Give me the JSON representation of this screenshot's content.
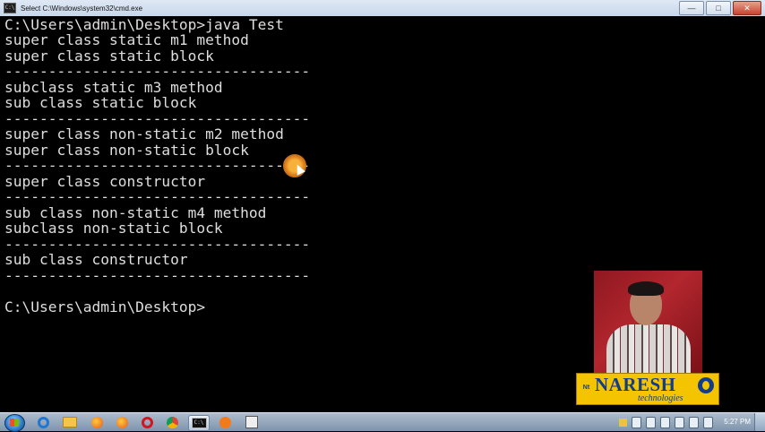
{
  "window": {
    "title": "Select C:\\Windows\\system32\\cmd.exe",
    "icon_text": "C:\\",
    "controls": {
      "minimize": "—",
      "maximize": "□",
      "close": "✕"
    }
  },
  "console": {
    "lines": [
      "C:\\Users\\admin\\Desktop>java Test",
      "super class static m1 method",
      "super class static block",
      "-----------------------------------",
      "subclass static m3 method",
      "sub class static block",
      "-----------------------------------",
      "super class non-static m2 method",
      "super class non-static block",
      "-----------------------------------",
      "super class constructor",
      "-----------------------------------",
      "sub class non-static m4 method",
      "subclass non-static block",
      "-----------------------------------",
      "sub class constructor",
      "-----------------------------------",
      "",
      "C:\\Users\\admin\\Desktop>"
    ]
  },
  "overlay": {
    "logo_name": "NARESH",
    "logo_subtitle": "technologies",
    "logo_badge": "Nt"
  },
  "taskbar": {
    "apps": [
      {
        "name": "internet-explorer",
        "icon": "ie-icon"
      },
      {
        "name": "file-explorer",
        "icon": "folder-icon"
      },
      {
        "name": "firefox",
        "icon": "firefox-icon"
      },
      {
        "name": "opera",
        "icon": "opera-icon"
      },
      {
        "name": "chrome",
        "icon": "chrome-icon"
      },
      {
        "name": "command-prompt",
        "icon": "cmd-icon"
      },
      {
        "name": "media-player",
        "icon": "media-icon"
      },
      {
        "name": "window",
        "icon": "window-icon"
      }
    ],
    "cmd_icon_text": "C:\\",
    "clock": "5:27 PM"
  }
}
